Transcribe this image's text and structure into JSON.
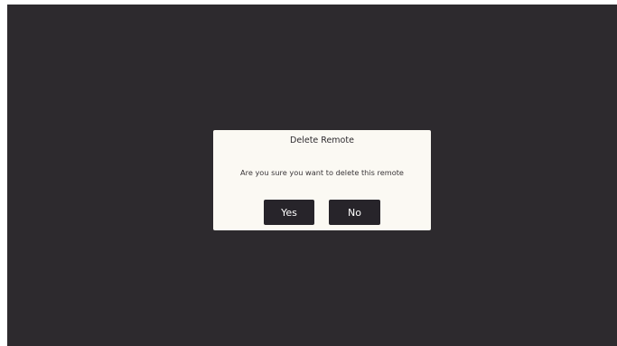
{
  "dialog": {
    "title": "Delete Remote",
    "message": "Are you sure you want to delete this remote",
    "yes_label": "Yes",
    "no_label": "No"
  },
  "colors": {
    "background": "#2d2a2e",
    "dialog_background": "#fbf9f3",
    "button_background": "#27242a",
    "button_text": "#ffffff"
  }
}
